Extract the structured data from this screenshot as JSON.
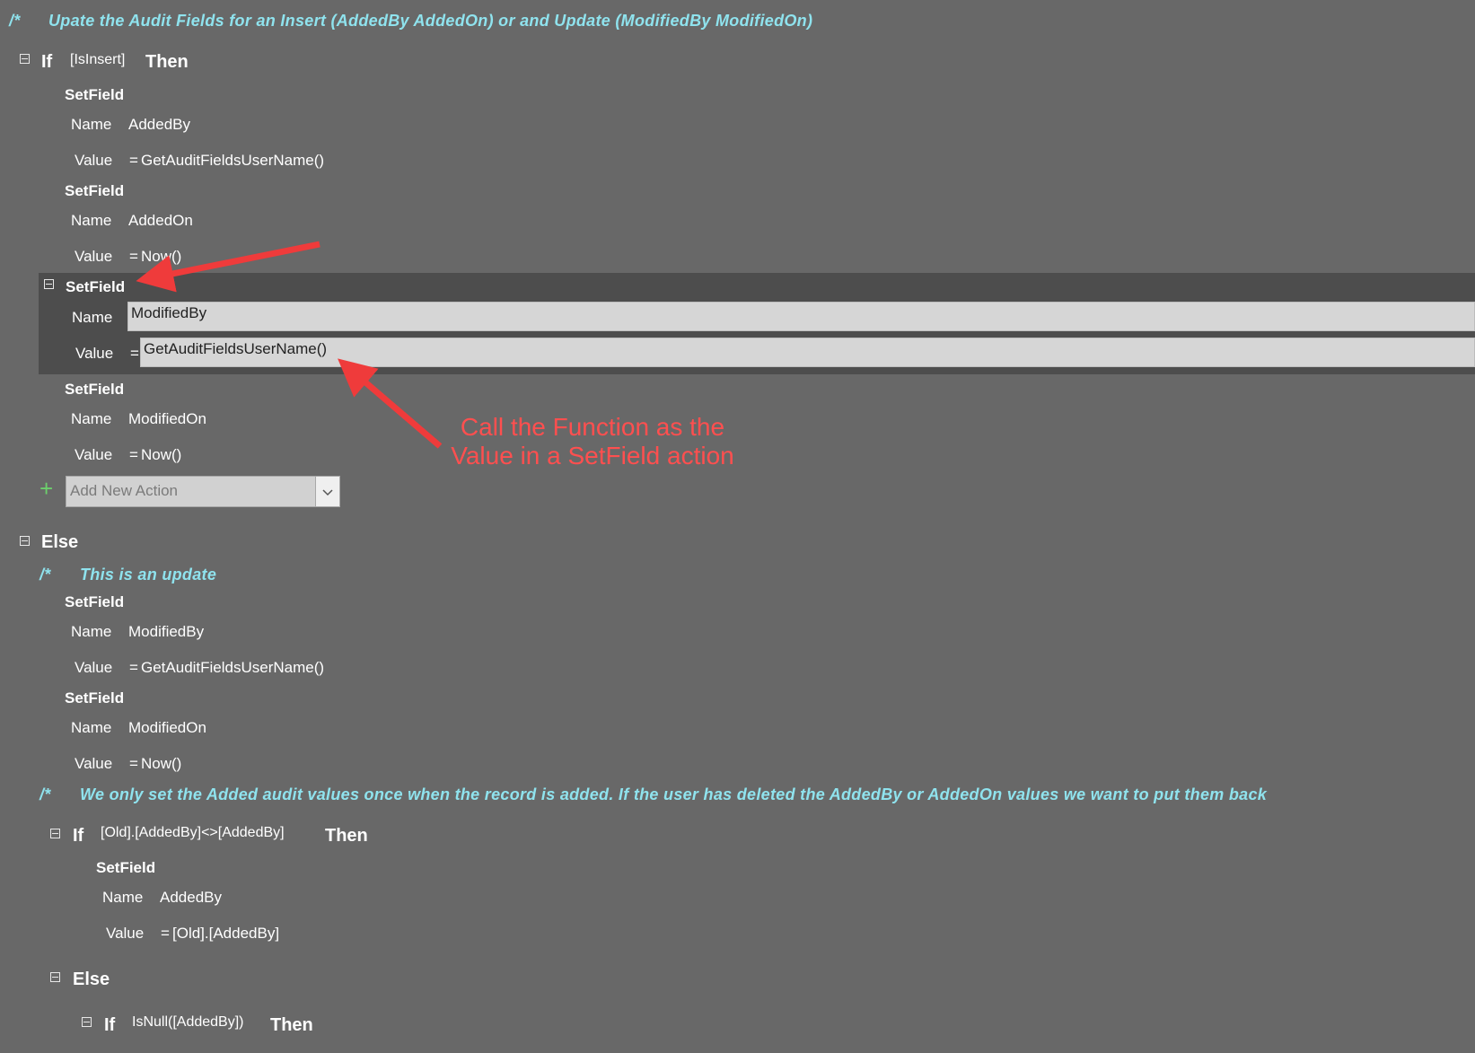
{
  "colors": {
    "comment": "#8fe3ee",
    "background": "#686868",
    "selected_band": "#4d4d4d",
    "annotation": "#ff4f4f",
    "add_icon": "#6ccf6c"
  },
  "comment1": {
    "marker": "/*",
    "text": "Upate the Audit Fields for an Insert (AddedBy AddedOn) or and Update (ModifiedBy ModifiedOn)"
  },
  "if1": {
    "kw": "If",
    "cond": "[IsInsert]",
    "then": "Then"
  },
  "sf1": {
    "action": "SetField",
    "name_label": "Name",
    "name": "AddedBy",
    "value_label": "Value",
    "eq": "=",
    "value": "GetAuditFieldsUserName()"
  },
  "sf2": {
    "action": "SetField",
    "name_label": "Name",
    "name": "AddedOn",
    "value_label": "Value",
    "eq": "=",
    "value": "Now()"
  },
  "sf3": {
    "action": "SetField",
    "name_label": "Name",
    "name": "ModifiedBy",
    "value_label": "Value",
    "eq": "=",
    "value": "GetAuditFieldsUserName()"
  },
  "sf4": {
    "action": "SetField",
    "name_label": "Name",
    "name": "ModifiedOn",
    "value_label": "Value",
    "eq": "=",
    "value": "Now()"
  },
  "add_action": {
    "placeholder": "Add New Action"
  },
  "annotation": {
    "line1": "Call the Function as the",
    "line2": "Value in a SetField action"
  },
  "else1": {
    "kw": "Else"
  },
  "comment2": {
    "marker": "/*",
    "text": "This is an update"
  },
  "sf5": {
    "action": "SetField",
    "name_label": "Name",
    "name": "ModifiedBy",
    "value_label": "Value",
    "eq": "=",
    "value": "GetAuditFieldsUserName()"
  },
  "sf6": {
    "action": "SetField",
    "name_label": "Name",
    "name": "ModifiedOn",
    "value_label": "Value",
    "eq": "=",
    "value": "Now()"
  },
  "comment3": {
    "marker": "/*",
    "text": "We only set the Added audit values once when the record is added.  If the user has deleted the AddedBy or AddedOn values we want to put them back"
  },
  "if2": {
    "kw": "If",
    "cond": "[Old].[AddedBy]<>[AddedBy]",
    "then": "Then"
  },
  "sf7": {
    "action": "SetField",
    "name_label": "Name",
    "name": "AddedBy",
    "value_label": "Value",
    "eq": "=",
    "value": "[Old].[AddedBy]"
  },
  "else2": {
    "kw": "Else"
  },
  "if3": {
    "kw": "If",
    "cond": "IsNull([AddedBy])",
    "then": "Then"
  }
}
